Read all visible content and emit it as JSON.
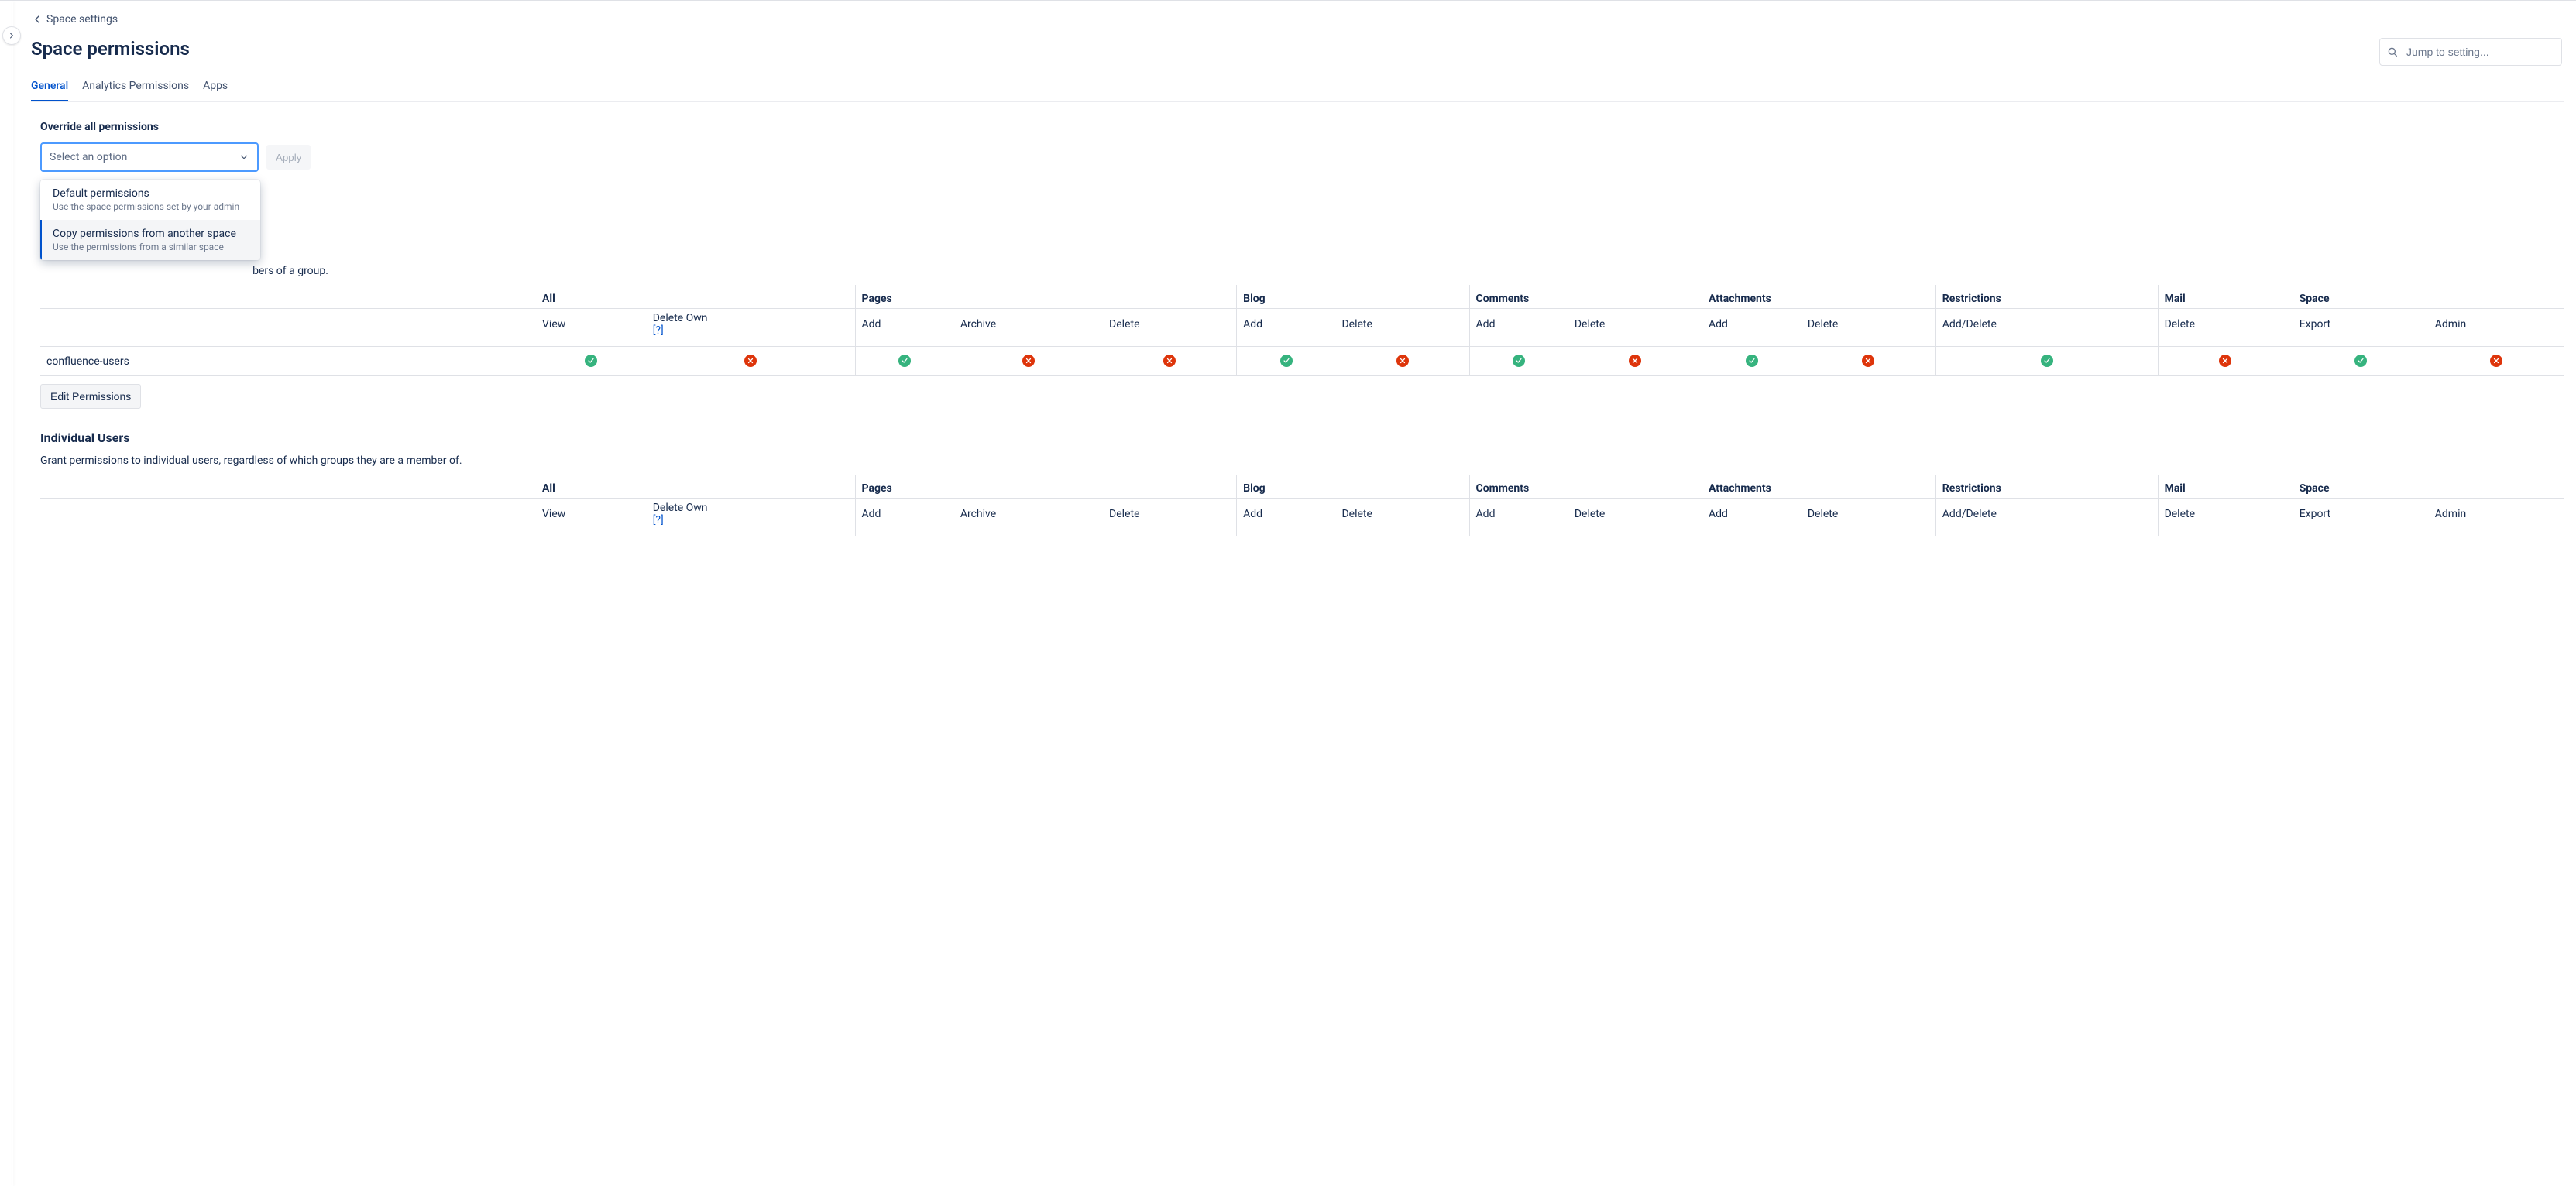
{
  "breadcrumb": {
    "label": "Space settings"
  },
  "page": {
    "title": "Space permissions"
  },
  "search": {
    "placeholder": "Jump to setting..."
  },
  "tabs": [
    {
      "label": "General",
      "active": true
    },
    {
      "label": "Analytics Permissions",
      "active": false
    },
    {
      "label": "Apps",
      "active": false
    }
  ],
  "override": {
    "heading": "Override all permissions",
    "placeholder": "Select an option",
    "apply": "Apply",
    "options": [
      {
        "title": "Default permissions",
        "sub": "Use the space permissions set by your admin",
        "hover": false
      },
      {
        "title": "Copy permissions from another space",
        "sub": "Use the permissions from a similar space",
        "hover": true
      }
    ]
  },
  "groups": {
    "description_suffix": "bers of a group.",
    "row_name": "confluence-users",
    "edit_label": "Edit Permissions",
    "values": [
      "tick",
      "cross",
      "tick",
      "cross",
      "cross",
      "tick",
      "cross",
      "tick",
      "cross",
      "tick",
      "cross",
      "tick",
      "cross",
      "tick",
      "cross"
    ]
  },
  "users": {
    "heading": "Individual Users",
    "description": "Grant permissions to individual users, regardless of which groups they are a member of."
  },
  "table": {
    "group_headers": [
      "",
      "All",
      "Pages",
      "Blog",
      "Comments",
      "Attachments",
      "Restrictions",
      "Mail",
      "Space"
    ],
    "sub_headers": [
      "",
      "View",
      "Delete Own",
      "Add",
      "Archive",
      "Delete",
      "Add",
      "Delete",
      "Add",
      "Delete",
      "Add",
      "Delete",
      "Add/Delete",
      "Delete",
      "Export",
      "Admin"
    ],
    "help": "[?]"
  }
}
